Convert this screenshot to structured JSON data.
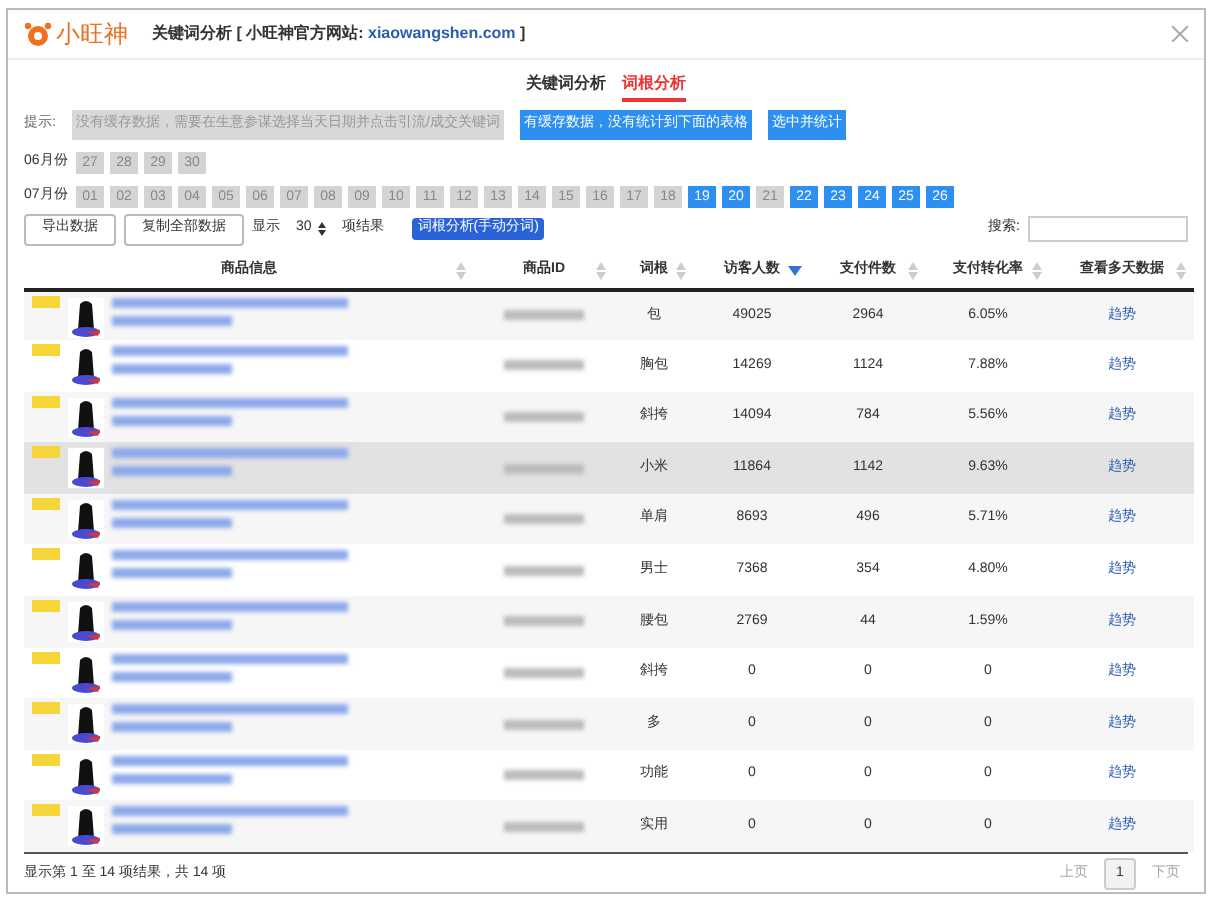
{
  "window": {
    "logo": "小旺神",
    "title": "关键词分析 [ 小旺神官方网站: ",
    "site": "xiaowangshen.com",
    "title_end": " ]"
  },
  "tabs": [
    {
      "label": "关键词分析",
      "selected": false
    },
    {
      "label": "词根分析",
      "selected": true
    }
  ],
  "hint": {
    "label": "提示:",
    "chips": [
      {
        "text": "没有缓存数据，需要在生意参谋选择当天日期并点击引流/成交关键词",
        "kind": "gray"
      },
      {
        "text": "有缓存数据，没有统计到下面的表格",
        "kind": "blue"
      },
      {
        "text": "选中并统计",
        "kind": "blue"
      }
    ]
  },
  "months": [
    {
      "label": "06月份",
      "days": [
        {
          "day": "27",
          "cached": false
        },
        {
          "day": "28",
          "cached": false
        },
        {
          "day": "29",
          "cached": false
        },
        {
          "day": "30",
          "cached": false
        }
      ]
    },
    {
      "label": "07月份",
      "days": [
        {
          "day": "01",
          "cached": false
        },
        {
          "day": "02",
          "cached": false
        },
        {
          "day": "03",
          "cached": false
        },
        {
          "day": "04",
          "cached": false
        },
        {
          "day": "05",
          "cached": false
        },
        {
          "day": "06",
          "cached": false
        },
        {
          "day": "07",
          "cached": false
        },
        {
          "day": "08",
          "cached": false
        },
        {
          "day": "09",
          "cached": false
        },
        {
          "day": "10",
          "cached": false
        },
        {
          "day": "11",
          "cached": false
        },
        {
          "day": "12",
          "cached": false
        },
        {
          "day": "13",
          "cached": false
        },
        {
          "day": "14",
          "cached": false
        },
        {
          "day": "15",
          "cached": false
        },
        {
          "day": "16",
          "cached": false
        },
        {
          "day": "17",
          "cached": false
        },
        {
          "day": "18",
          "cached": false
        },
        {
          "day": "19",
          "cached": true
        },
        {
          "day": "20",
          "cached": true
        },
        {
          "day": "21",
          "cached": false
        },
        {
          "day": "22",
          "cached": true
        },
        {
          "day": "23",
          "cached": true
        },
        {
          "day": "24",
          "cached": true
        },
        {
          "day": "25",
          "cached": true
        },
        {
          "day": "26",
          "cached": true
        }
      ]
    }
  ],
  "toolbar": {
    "buttons": [
      "导出数据",
      "复制全部数据"
    ],
    "show_label": "显示",
    "page_size": "30",
    "results_label": "项结果",
    "analyze_button": "词根分析(手动分词)",
    "search_label": "搜索:"
  },
  "table": {
    "columns": [
      {
        "label": "商品信息",
        "sorted": false
      },
      {
        "label": "商品ID",
        "sorted": false
      },
      {
        "label": "词根",
        "sorted": false
      },
      {
        "label": "访客人数",
        "sorted": true
      },
      {
        "label": "支付件数",
        "sorted": false
      },
      {
        "label": "支付转化率",
        "sorted": false
      },
      {
        "label": "查看多天数据",
        "sorted": false
      }
    ],
    "rows": [
      {
        "root": "包",
        "visitors": "49025",
        "paid": "2964",
        "rate": "6.05%",
        "link": "趋势",
        "selected": false
      },
      {
        "root": "胸包",
        "visitors": "14269",
        "paid": "1124",
        "rate": "7.88%",
        "link": "趋势",
        "selected": false
      },
      {
        "root": "斜挎",
        "visitors": "14094",
        "paid": "784",
        "rate": "5.56%",
        "link": "趋势",
        "selected": false
      },
      {
        "root": "小米",
        "visitors": "11864",
        "paid": "1142",
        "rate": "9.63%",
        "link": "趋势",
        "selected": true
      },
      {
        "root": "单肩",
        "visitors": "8693",
        "paid": "496",
        "rate": "5.71%",
        "link": "趋势",
        "selected": false
      },
      {
        "root": "男士",
        "visitors": "7368",
        "paid": "354",
        "rate": "4.80%",
        "link": "趋势",
        "selected": false
      },
      {
        "root": "腰包",
        "visitors": "2769",
        "paid": "44",
        "rate": "1.59%",
        "link": "趋势",
        "selected": false
      },
      {
        "root": "斜挎",
        "visitors": "0",
        "paid": "0",
        "rate": "0",
        "link": "趋势",
        "selected": false
      },
      {
        "root": "多",
        "visitors": "0",
        "paid": "0",
        "rate": "0",
        "link": "趋势",
        "selected": false
      },
      {
        "root": "功能",
        "visitors": "0",
        "paid": "0",
        "rate": "0",
        "link": "趋势",
        "selected": false
      },
      {
        "root": "实用",
        "visitors": "0",
        "paid": "0",
        "rate": "0",
        "link": "趋势",
        "selected": false
      }
    ]
  },
  "footer": {
    "summary": "显示第 1 至 14 项结果，共 14 项",
    "prev": "上页",
    "page": "1",
    "next": "下页"
  }
}
